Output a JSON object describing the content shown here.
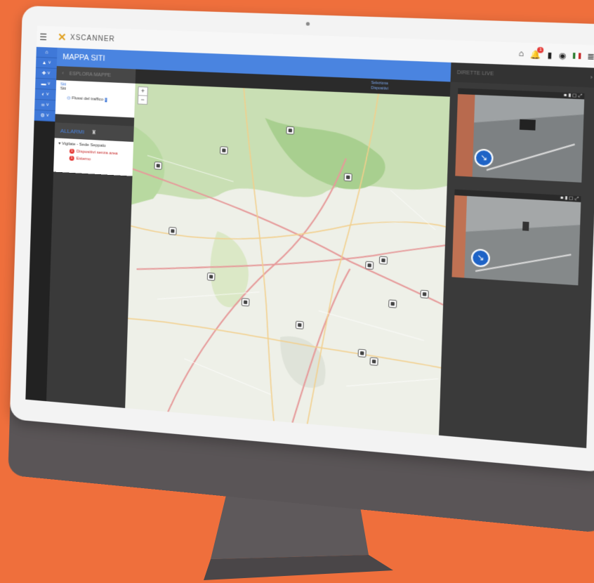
{
  "colors": {
    "background": "#ef6f3c",
    "accent": "#4a84e0",
    "alarm": "#e53935"
  },
  "header": {
    "logo_mark": "✕",
    "logo_text": "XSCANNER",
    "icons": [
      "bell-icon",
      "notification-icon",
      "badge-icon",
      "user-icon",
      "flag-icon",
      "menu-icon"
    ],
    "notification_count": "1"
  },
  "nav": {
    "items": [
      "home-icon",
      "bell-icon",
      "arrow-icon",
      "car-icon",
      "camera-icon",
      "link-icon",
      "settings-icon"
    ]
  },
  "page": {
    "title": "MAPPA SITI"
  },
  "explore_panel": {
    "title": "ESPLORA MAPPE",
    "selector_label": "Siti",
    "selector_value": "Siti",
    "layer_item": "Flussi del traffico"
  },
  "alarms": {
    "title": "ALLARMI",
    "group": "Vigilate - Sede Seppalo",
    "items": [
      {
        "count": "1",
        "label": "Dispositivi senza area"
      },
      {
        "count": "1",
        "label": "Esterno"
      }
    ]
  },
  "map_toolbar": {
    "filter_label": "Seleziona",
    "filter_value": "Dispositivi"
  },
  "right_panel": {
    "title": "DIRETTE LIVE",
    "cameras": [
      {
        "name": "camera-1"
      },
      {
        "name": "camera-2"
      }
    ]
  }
}
